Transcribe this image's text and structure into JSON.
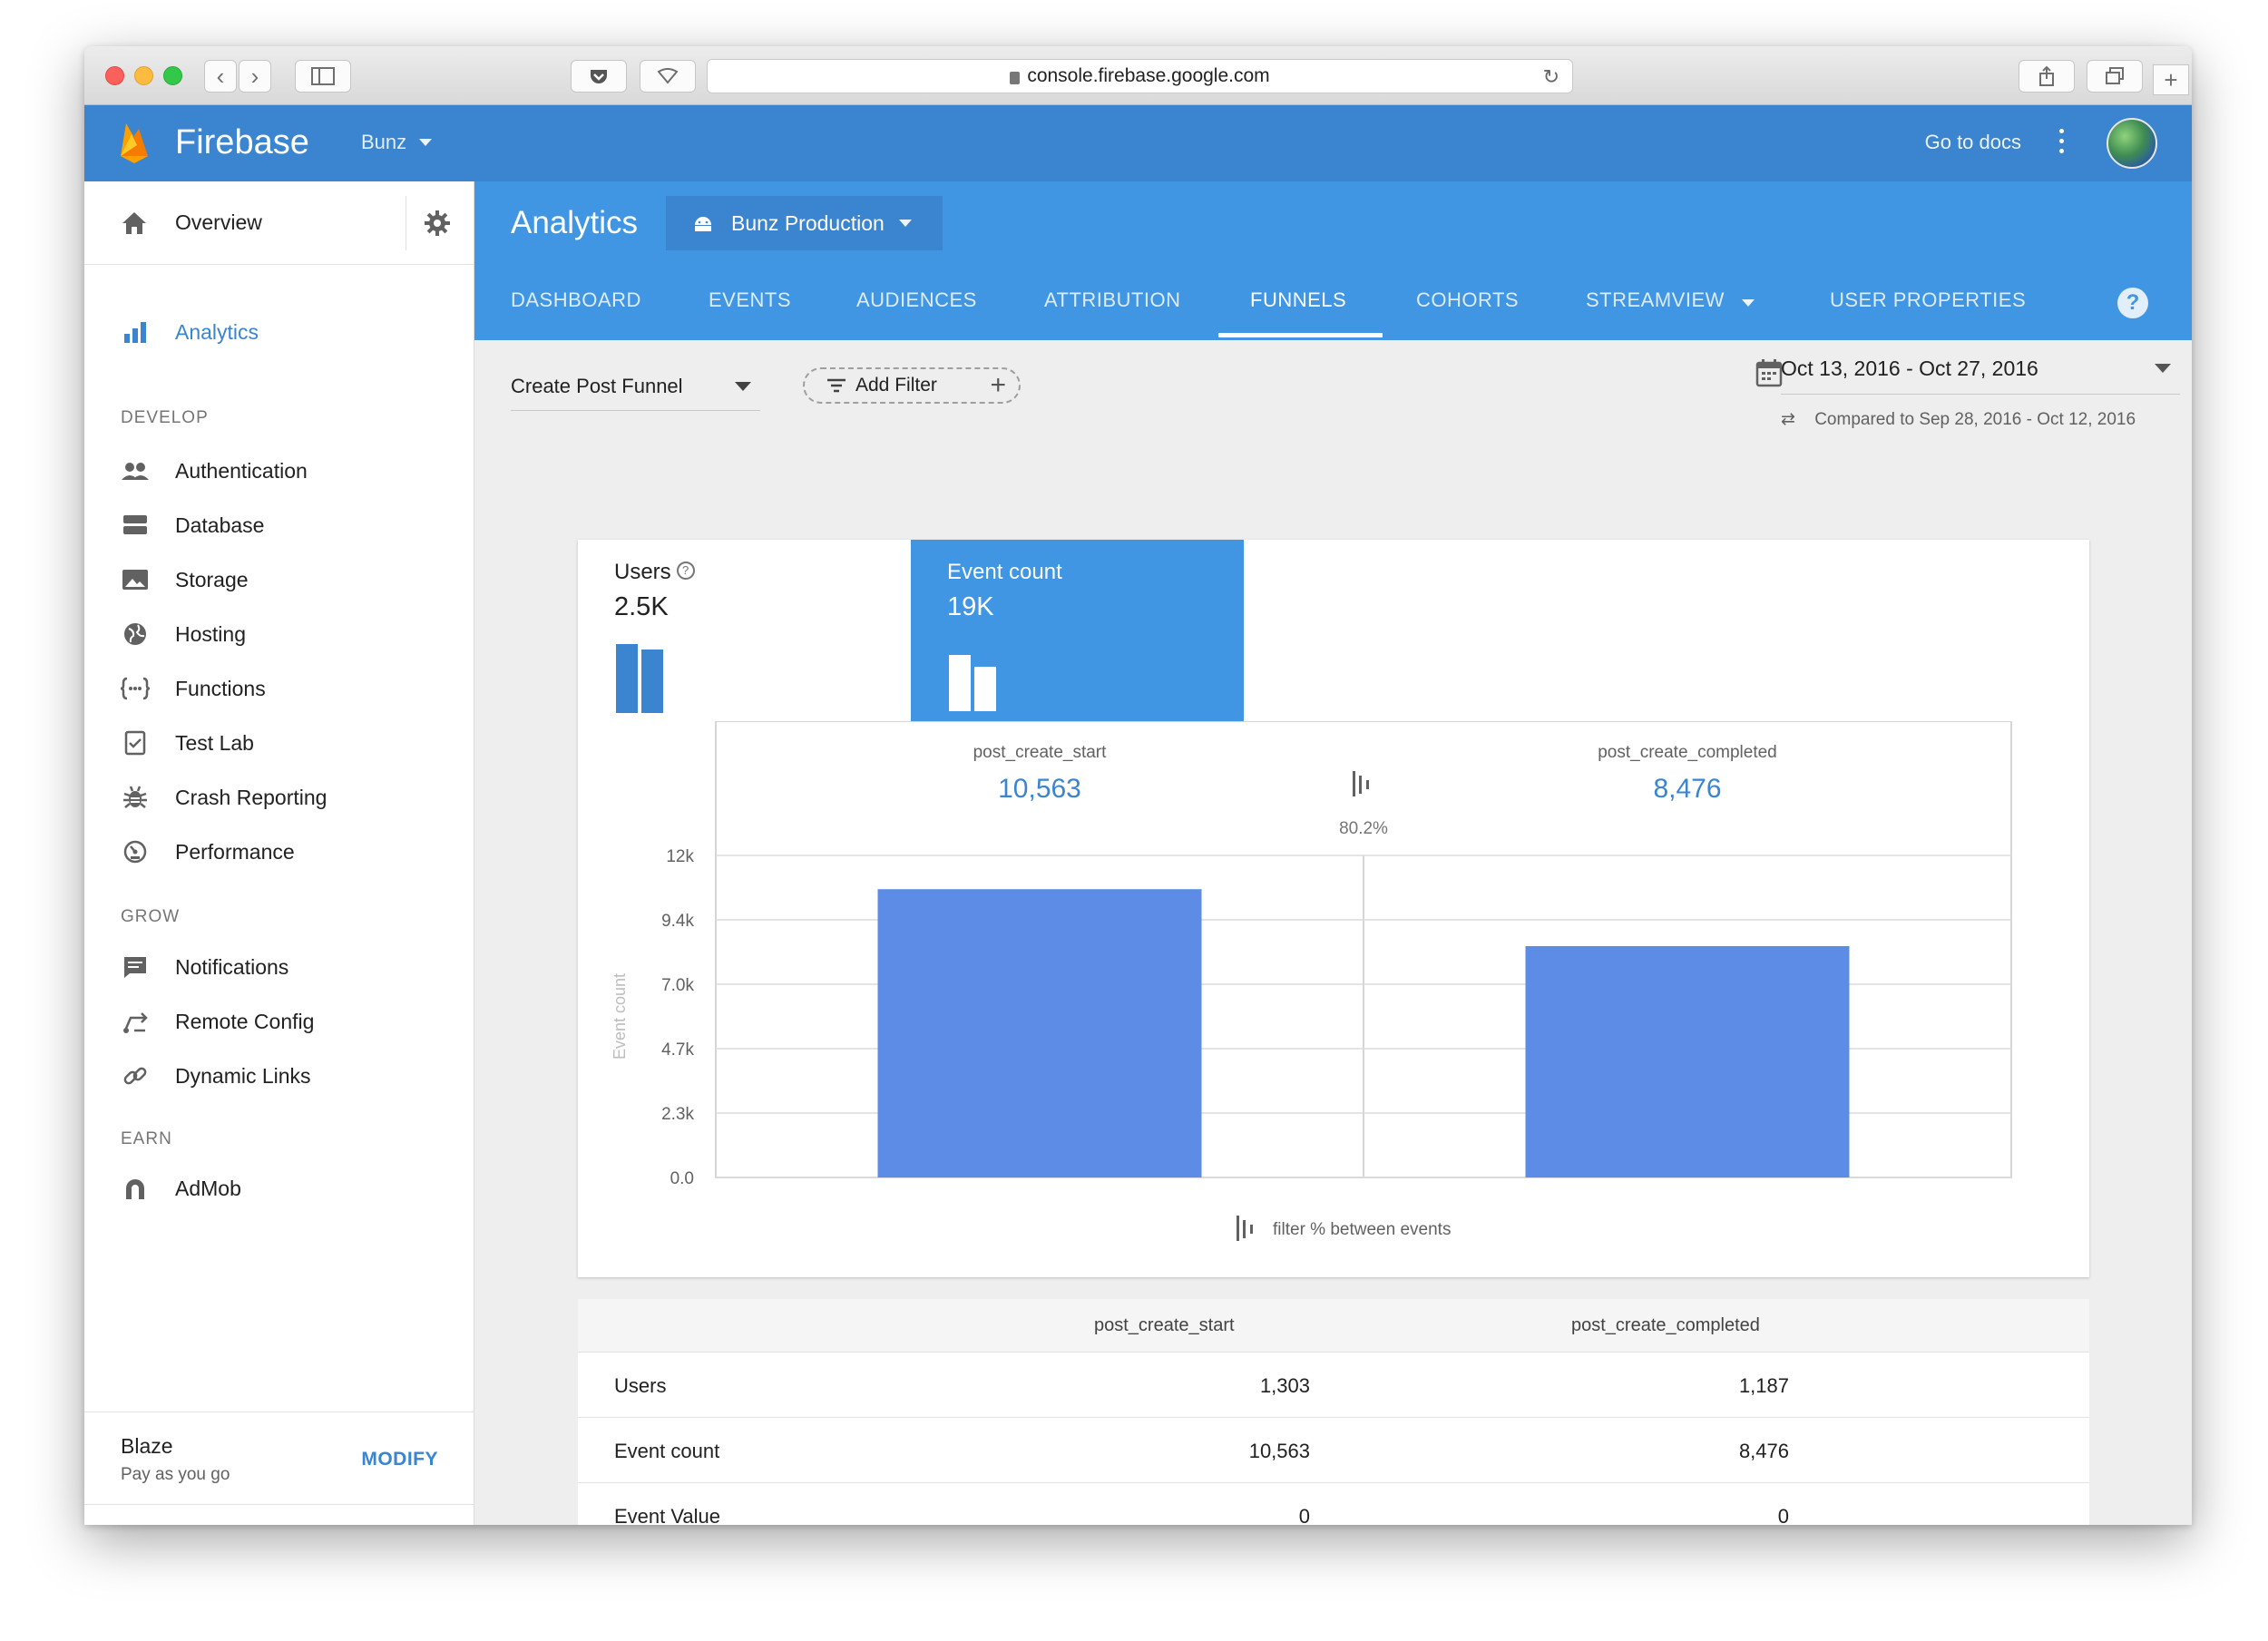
{
  "browser": {
    "url": "console.firebase.google.com"
  },
  "topbar": {
    "brand": "Firebase",
    "project": "Bunz",
    "docs_link": "Go to docs"
  },
  "sidebar": {
    "overview": "Overview",
    "analytics": "Analytics",
    "sections": {
      "develop": "DEVELOP",
      "grow": "GROW",
      "earn": "EARN"
    },
    "develop_items": [
      "Authentication",
      "Database",
      "Storage",
      "Hosting",
      "Functions",
      "Test Lab",
      "Crash Reporting",
      "Performance"
    ],
    "grow_items": [
      "Notifications",
      "Remote Config",
      "Dynamic Links"
    ],
    "earn_items": [
      "AdMob"
    ],
    "plan": {
      "name": "Blaze",
      "subtitle": "Pay as you go",
      "modify": "MODIFY"
    }
  },
  "analytics": {
    "title": "Analytics",
    "app_selector": "Bunz Production",
    "tabs": [
      "DASHBOARD",
      "EVENTS",
      "AUDIENCES",
      "ATTRIBUTION",
      "FUNNELS",
      "COHORTS",
      "STREAMVIEW",
      "USER PROPERTIES"
    ],
    "active_tab": "FUNNELS"
  },
  "filters": {
    "funnel": "Create Post Funnel",
    "add_filter": "Add Filter",
    "date_range": "Oct 13, 2016 - Oct 27, 2016",
    "compared": "Compared to Sep 28, 2016 - Oct 12, 2016"
  },
  "metrics": {
    "users": {
      "label": "Users",
      "value": "2.5K"
    },
    "event_count": {
      "label": "Event count",
      "value": "19K"
    }
  },
  "chart_data": {
    "type": "bar",
    "categories": [
      "post_create_start",
      "post_create_completed"
    ],
    "category_values_label": [
      "10,563",
      "8,476"
    ],
    "values": [
      10563,
      8476
    ],
    "conversion": "80.2%",
    "ylabel": "Event count",
    "yticks": [
      "0.0",
      "2.3k",
      "4.7k",
      "7.0k",
      "9.4k",
      "12k"
    ],
    "ylim": [
      0,
      11800
    ],
    "footer": "filter % between events",
    "color": "#5c8ce6"
  },
  "table": {
    "columns": [
      "",
      "post_create_start",
      "post_create_completed"
    ],
    "rows": [
      [
        "Users",
        "1,303",
        "1,187"
      ],
      [
        "Event count",
        "10,563",
        "8,476"
      ],
      [
        "Event Value",
        "0",
        "0"
      ]
    ]
  },
  "colors": {
    "topbar": "#3a84d0",
    "header": "#4096e2",
    "accent": "#3a84d0",
    "bar": "#5c8ce6"
  }
}
